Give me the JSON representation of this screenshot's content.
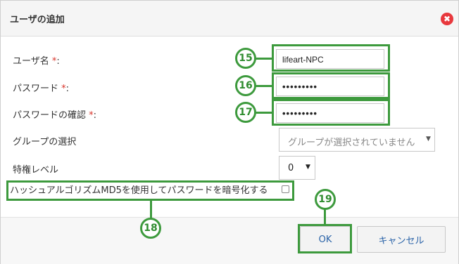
{
  "dialog": {
    "title": "ユーザの追加",
    "close_icon": "✖"
  },
  "form": {
    "username": {
      "label": "ユーザ名",
      "required_mark": "*",
      "colon": ":",
      "value": "lifeart-NPC"
    },
    "password": {
      "label": "パスワード",
      "required_mark": "*",
      "colon": ":",
      "value": "•••••••••"
    },
    "password_confirm": {
      "label": "パスワードの確認",
      "required_mark": "*",
      "colon": ":",
      "value": "•••••••••"
    },
    "group": {
      "label": "グループの選択",
      "selected": "グループが選択されていません"
    },
    "privilege": {
      "label": "特権レベル",
      "selected": "0"
    },
    "hash_md5": {
      "label": "ハッシュアルゴリズムMD5を使用してパスワードを暗号化する",
      "checked": false
    }
  },
  "annotations": {
    "callouts": [
      "15",
      "16",
      "17",
      "18",
      "19"
    ],
    "color": "#3d9a3d"
  },
  "buttons": {
    "ok": "OK",
    "cancel": "キャンセル"
  },
  "colors": {
    "required": "#d9342b",
    "link_text": "#2a63a8",
    "close": "#e8383d"
  }
}
